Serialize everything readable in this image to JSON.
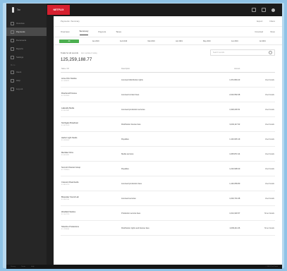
{
  "topbar": {
    "brand": "NETFLIX"
  },
  "sidebar": {
    "logo_text": "Tax",
    "items": [
      {
        "label": "Overview",
        "active": false
      },
      {
        "label": "Payments",
        "active": true
      },
      {
        "label": "Documents",
        "active": false
      },
      {
        "label": "Reports",
        "active": false
      },
      {
        "label": "Settings",
        "active": false
      }
    ],
    "section2_head": "More",
    "items2": [
      {
        "label": "Users"
      },
      {
        "label": "Help"
      },
      {
        "label": "Log out"
      }
    ]
  },
  "breadcrumb": {
    "left": "Payments / Summary",
    "right1": "Export",
    "right2": "Filters"
  },
  "tabs": [
    "Overview",
    "Summary",
    "Payouts",
    "Taxes"
  ],
  "tab_actions": [
    "Download",
    "Share"
  ],
  "filters": [
    "All",
    "Jan 2019",
    "Feb 2019",
    "Mar 2019",
    "Apr 2019",
    "May 2019",
    "Jun 2019",
    "Jul 2019"
  ],
  "summary": {
    "label": "Totals for all records",
    "muted": "last updated today",
    "search_placeholder": "Search records"
  },
  "total_amount": "125,259,188.77",
  "table": {
    "headers": [
      "Name / ID",
      "Description",
      "Amount",
      ""
    ],
    "rows": [
      {
        "name": "Acme Film Studios",
        "id": "ID 1038221",
        "desc": "Licensed distribution rights",
        "amount": "1,372,849.23",
        "action": "View Details"
      },
      {
        "name": "Riverbend Pictures",
        "id": "ID 2281904",
        "desc": "Licensed content fees",
        "amount": "2,610,552.08",
        "action": "View Details"
      },
      {
        "name": "Lakeside Media",
        "id": "ID 3341187",
        "desc": "Licensed production services",
        "amount": "1,918,226.51",
        "action": "View Details"
      },
      {
        "name": "Northgate Broadcast",
        "id": "ID 4412039",
        "desc": "Distribution license fees",
        "amount": "3,204,117.62",
        "action": "View Details"
      },
      {
        "name": "Harbor Light Studio",
        "id": "ID 5538102",
        "desc": "Royalties",
        "amount": "1,123,045.19",
        "action": "View Details"
      },
      {
        "name": "Meridian Films",
        "id": "ID 6620451",
        "desc": "Media services",
        "amount": "1,005,872.44",
        "action": "View Details"
      },
      {
        "name": "Summit Channel Group",
        "id": "ID 7789310",
        "desc": "Royalties",
        "amount": "1,210,938.20",
        "action": "View Details"
      },
      {
        "name": "Crescent Road Audio",
        "id": "ID 8810276",
        "desc": "Licensed production fees",
        "amount": "1,120,059.80",
        "action": "View Details"
      },
      {
        "name": "Bluewater Sound Lab",
        "id": "ID 9902114",
        "desc": "Licensed services",
        "amount": "1,019,731.08",
        "action": "View Details"
      },
      {
        "name": "Westfield Studios",
        "id": "ID 1047725",
        "desc": "Production service fees",
        "amount": "1,014,320.57",
        "action": "Show Details"
      },
      {
        "name": "Silverline Productions",
        "id": "ID 1159840",
        "desc": "Distribution rights and license fees",
        "amount": "1,009,211.06",
        "action": "Show Details"
      }
    ]
  },
  "footer": {
    "left1": "Privacy",
    "left2": "Terms",
    "left3": "Help",
    "right": "© 2019 Tax Portal"
  }
}
